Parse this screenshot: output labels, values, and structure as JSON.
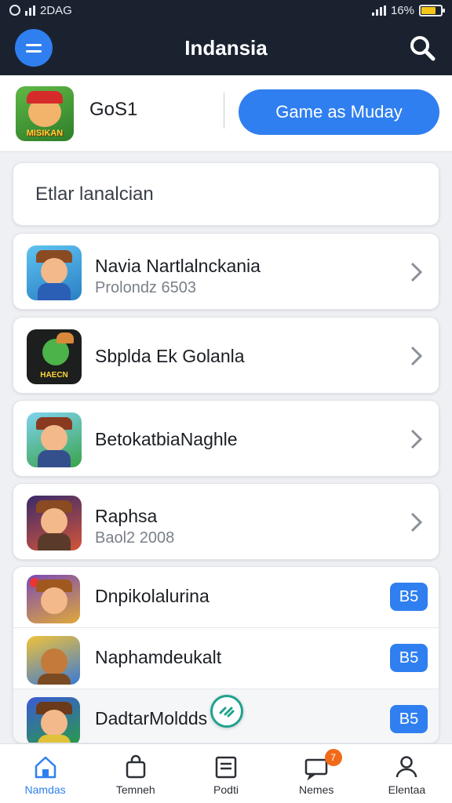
{
  "status_bar": {
    "network": "2DAG",
    "battery_text": "16%",
    "battery_level": 0.7
  },
  "app_bar": {
    "title": "Indansia"
  },
  "featured": {
    "icon_text": "MISIKAN",
    "name": "GoS1",
    "cta_label": "Game as Muday"
  },
  "search": {
    "text": "Etlar lanalcian"
  },
  "games": [
    {
      "title": "Navia Nartlalnckania",
      "subtitle": "Prolondz 6503",
      "icon_text": ""
    },
    {
      "title": "Sbplda Ek Golanla",
      "subtitle": "",
      "icon_text": "HAECN"
    },
    {
      "title": "BetokatbiaNaghle",
      "subtitle": "",
      "icon_text": ""
    },
    {
      "title": "Raphsa",
      "subtitle": "Baol2 2008",
      "icon_text": ""
    }
  ],
  "group": [
    {
      "title": "Dnpikolalurina",
      "badge": "B5"
    },
    {
      "title": "Naphamdeukalt",
      "badge": "B5"
    },
    {
      "title": "DadtarMoldds",
      "badge": "B5"
    }
  ],
  "bottom_nav": [
    {
      "label": "Namdas",
      "icon": "home-icon",
      "active": true
    },
    {
      "label": "Temneh",
      "icon": "bag-icon",
      "active": false
    },
    {
      "label": "Podti",
      "icon": "document-icon",
      "active": false
    },
    {
      "label": "Nemes",
      "icon": "chat-icon",
      "active": false,
      "badge": "7"
    },
    {
      "label": "Elentaa",
      "icon": "profile-icon",
      "active": false
    }
  ],
  "colors": {
    "accent": "#2f7ff0",
    "header": "#1a2230",
    "badge": "#f06a1a"
  }
}
